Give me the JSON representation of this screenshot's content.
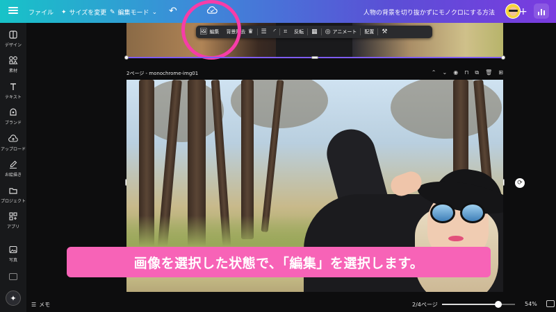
{
  "topbar": {
    "file_label": "ファイル",
    "resize_label": "サイズを変更",
    "edit_mode_label": "編集モード",
    "undo_icon": "undo-icon",
    "cloud_icon": "cloud-save-icon",
    "doc_title": "人物の背景を切り抜かずにモノクロにする方法",
    "plus_label": "+"
  },
  "sidebar": {
    "items": [
      {
        "label": "デザイン",
        "icon": "design-icon"
      },
      {
        "label": "素材",
        "icon": "elements-icon"
      },
      {
        "label": "テキスト",
        "icon": "text-icon"
      },
      {
        "label": "ブランド",
        "icon": "brand-icon"
      },
      {
        "label": "アップロード",
        "icon": "upload-icon"
      },
      {
        "label": "お絵描き",
        "icon": "draw-icon"
      },
      {
        "label": "プロジェクト",
        "icon": "folder-icon"
      },
      {
        "label": "アプリ",
        "icon": "apps-icon"
      },
      {
        "label": "写真",
        "icon": "photo-icon"
      }
    ]
  },
  "element_toolbar": {
    "edit_label": "編集",
    "bg_remove_label": "背景除去",
    "flip_label": "反転",
    "animate_label": "アニメート",
    "position_label": "配置"
  },
  "page": {
    "label": "2ページ - monochrome-img01"
  },
  "caption": "画像を選択した状態で、「編集」を選択します。",
  "bottombar": {
    "notes_label": "メモ",
    "page_counter": "2/4ページ",
    "zoom_label": "54%",
    "zoom_fraction": 0.54
  },
  "colors": {
    "highlight": "#f73ca8",
    "caption_bg": "#f763b7",
    "selection": "#7e5cf0"
  }
}
